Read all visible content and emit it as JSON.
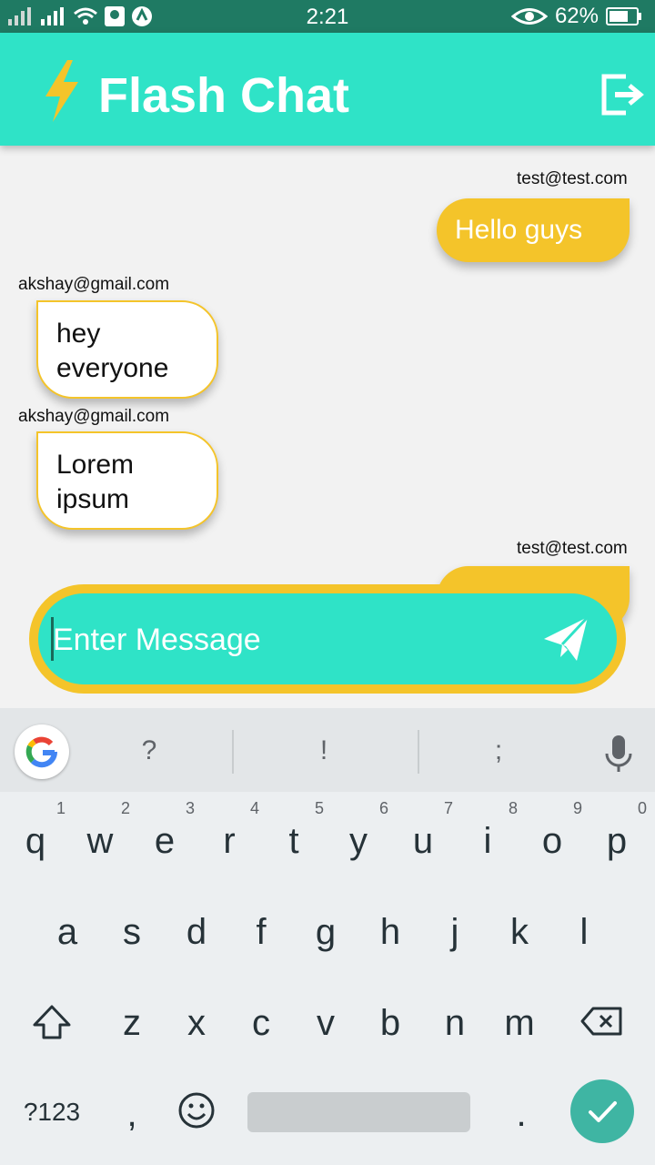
{
  "status_bar": {
    "time": "2:21",
    "battery": "62%"
  },
  "app": {
    "title": "Flash Chat",
    "accent": "#2fe3c7",
    "bubble_color": "#f4c42a"
  },
  "messages": [
    {
      "sender": "test@test.com",
      "text": "Hello guys",
      "is_me": true
    },
    {
      "sender": "akshay@gmail.com",
      "text": "hey everyone",
      "is_me": false
    },
    {
      "sender": "akshay@gmail.com",
      "text": "Lorem ipsum",
      "is_me": false
    },
    {
      "sender": "test@test.com",
      "text": "",
      "is_me": true
    }
  ],
  "composer": {
    "placeholder": "Enter Message"
  },
  "keyboard": {
    "suggestions": [
      "?",
      "!",
      ";"
    ],
    "row1": [
      "q",
      "w",
      "e",
      "r",
      "t",
      "y",
      "u",
      "i",
      "o",
      "p"
    ],
    "row1_nums": [
      "1",
      "2",
      "3",
      "4",
      "5",
      "6",
      "7",
      "8",
      "9",
      "0"
    ],
    "row2": [
      "a",
      "s",
      "d",
      "f",
      "g",
      "h",
      "j",
      "k",
      "l"
    ],
    "row3": [
      "z",
      "x",
      "c",
      "v",
      "b",
      "n",
      "m"
    ],
    "symbols_label": "?123",
    "comma": ",",
    "period": "."
  }
}
